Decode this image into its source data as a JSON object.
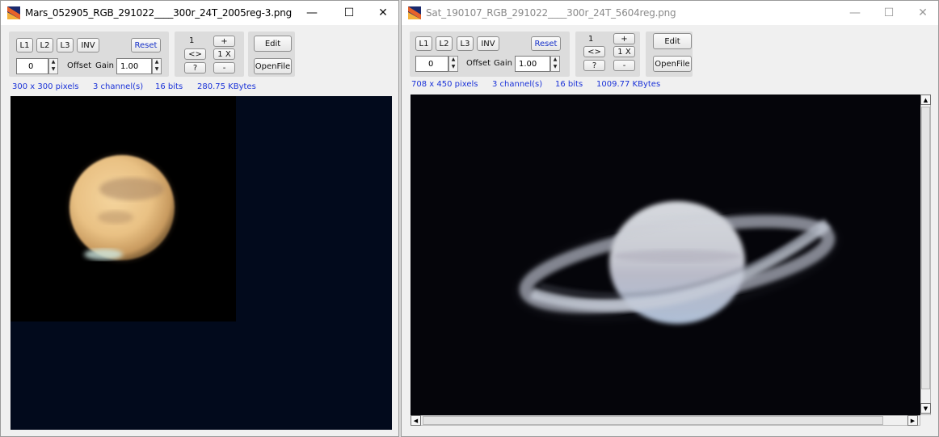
{
  "left": {
    "title": "Mars_052905_RGB_291022____300r_24T_2005reg-3.png",
    "window_buttons": {
      "minimize": "—",
      "maximize": "☐",
      "close": "✕"
    },
    "toolbar": {
      "l1": "L1",
      "l2": "L2",
      "l3": "L3",
      "inv": "INV",
      "reset": "Reset",
      "offset_value": "0",
      "offset_label": "Offset",
      "gain_label": "Gain",
      "gain_value": "1.00",
      "zoom_one": "1",
      "zoom_plus": "+",
      "swap": "<>",
      "zoom_1x": "1 X",
      "help": "?",
      "zoom_minus": "-",
      "edit": "Edit",
      "openfile": "OpenFile"
    },
    "info": {
      "dims": "300  x  300  pixels",
      "channels": "3  channel(s)",
      "bits": "16 bits",
      "size": "280.75 KBytes"
    }
  },
  "right": {
    "title": "Sat_190107_RGB_291022____300r_24T_5604reg.png",
    "window_buttons": {
      "minimize": "—",
      "maximize": "☐",
      "close": "✕"
    },
    "toolbar": {
      "l1": "L1",
      "l2": "L2",
      "l3": "L3",
      "inv": "INV",
      "reset": "Reset",
      "offset_value": "0",
      "offset_label": "Offset",
      "gain_label": "Gain",
      "gain_value": "1.00",
      "zoom_one": "1",
      "zoom_plus": "+",
      "swap": "<>",
      "zoom_1x": "1 X",
      "help": "?",
      "zoom_minus": "-",
      "edit": "Edit",
      "openfile": "OpenFile"
    },
    "info": {
      "dims": "708  x  450  pixels",
      "channels": "3  channel(s)",
      "bits": "16 bits",
      "size": "1009.77 KBytes"
    },
    "scrollbar_arrows": {
      "up": "▲",
      "down": "▼",
      "left": "◀",
      "right": "▶"
    }
  },
  "colors": {
    "info_text": "#1a32d8",
    "mars_canvas_bg": "#020a1c",
    "saturn_canvas_bg": "#05050a"
  },
  "icons": [
    "app-icon",
    "minimize-icon",
    "maximize-icon",
    "close-icon",
    "spin-up-icon",
    "spin-down-icon",
    "scroll-up-icon",
    "scroll-down-icon",
    "scroll-left-icon",
    "scroll-right-icon"
  ]
}
